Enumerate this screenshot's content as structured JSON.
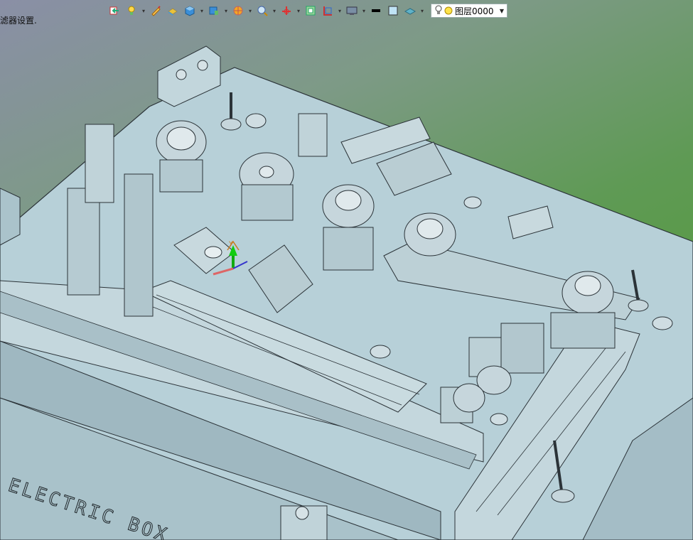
{
  "status_text": "滤器设置.",
  "toolbar": {
    "items": [
      "import-icon",
      "light-icon",
      "pen-icon",
      "block-icon",
      "cube-icon",
      "view-cube-icon",
      "sun-icon",
      "zoom-icon",
      "axis-icon",
      "grid-icon",
      "frame-icon",
      "monitor-icon",
      "line-color-icon",
      "fill-color-icon",
      "layer-shape-icon"
    ],
    "layer_select": {
      "value": "图层0000"
    }
  },
  "scene": {
    "label": "ELECTRIC BOX",
    "colors": {
      "body": "#b7d0d8",
      "edge": "#2b3338",
      "dark": "#8ea7b0",
      "panel": "#a6c0c9",
      "motor": "#c6d6dc"
    }
  }
}
